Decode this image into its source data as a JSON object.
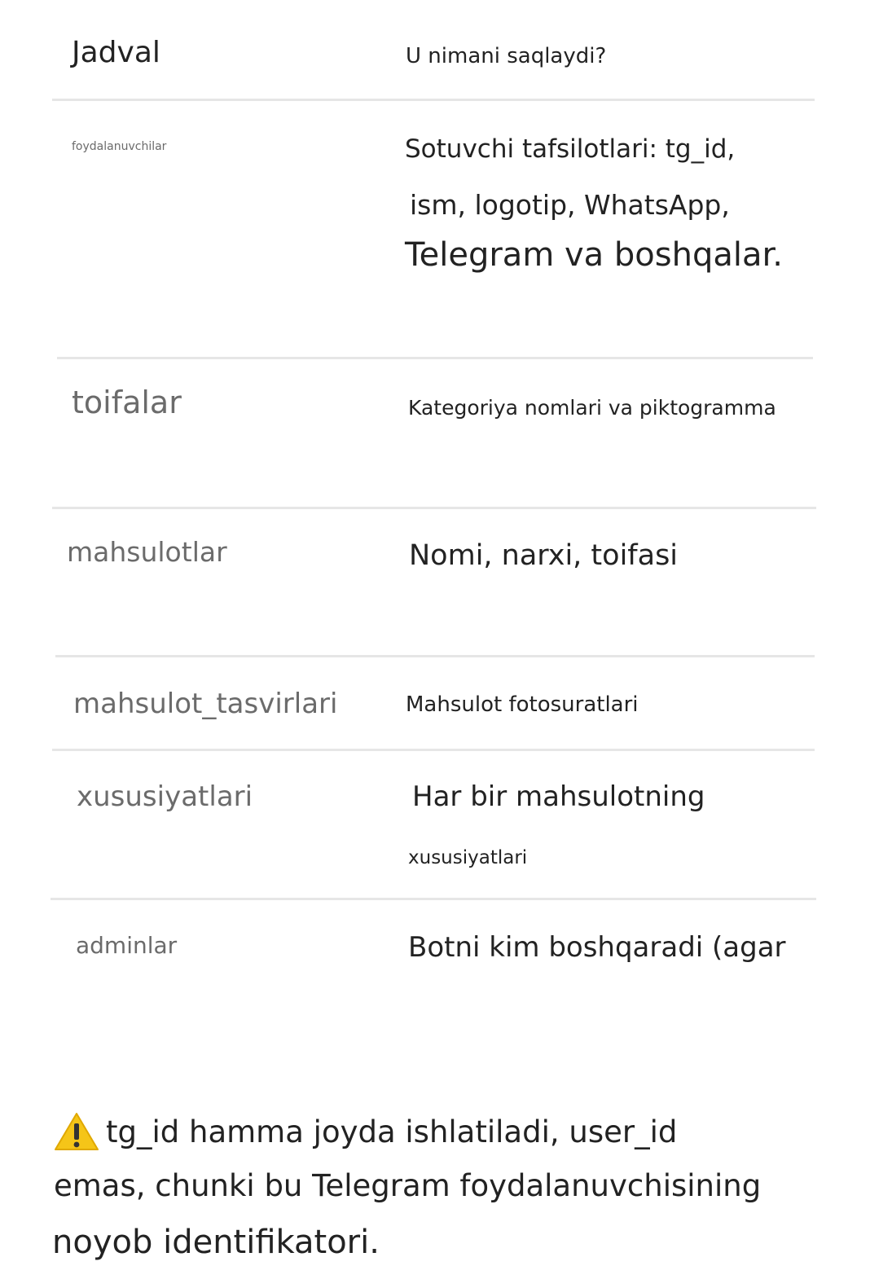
{
  "header": {
    "col_table": "Jadval",
    "col_stores": "U nimani saqlaydi?"
  },
  "rows": [
    {
      "name": "foydalanuvchilar",
      "desc_lines": [
        "Sotuvchi tafsilotlari: tg_id,",
        "ism, logotip, WhatsApp,",
        "Telegram va boshqalar."
      ]
    },
    {
      "name": "toifalar",
      "desc_lines": [
        "Kategoriya nomlari va piktogramma"
      ]
    },
    {
      "name": "mahsulotlar",
      "desc_lines": [
        "Nomi, narxi, toifasi"
      ]
    },
    {
      "name": "mahsulot_tasvirlari",
      "desc_lines": [
        "Mahsulot fotosuratlari"
      ]
    },
    {
      "name": "xususiyatlari",
      "desc_lines": [
        "Har bir mahsulotning",
        "xususiyatlari"
      ]
    },
    {
      "name": "adminlar",
      "desc_lines": [
        "Botni kim boshqaradi (agar"
      ]
    }
  ],
  "note": {
    "icon": "warning-icon",
    "lines": [
      "tg_id hamma joyda ishlatiladi, user_id",
      "emas, chunki bu Telegram foydalanuvchisining",
      "noyob identifikatori."
    ]
  },
  "colors": {
    "warning_fill": "#f5c518",
    "warning_mark": "#333333",
    "separator": "#e6e6e6"
  }
}
